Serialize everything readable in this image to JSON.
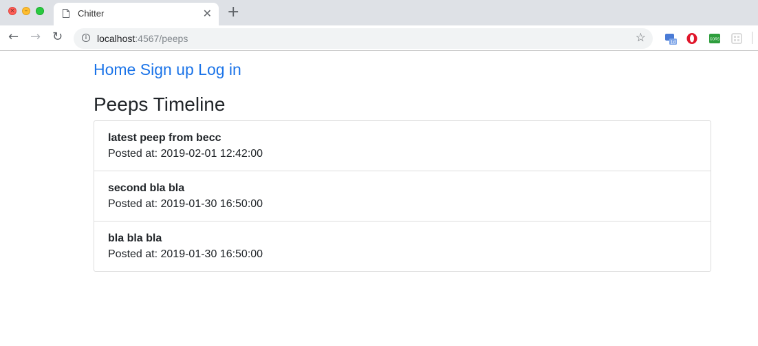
{
  "browser": {
    "tab_title": "Chitter",
    "url_host": "localhost",
    "url_rest": ":4567/peeps"
  },
  "nav": {
    "home": "Home",
    "signup": "Sign up",
    "login": "Log in"
  },
  "page_title": "Peeps Timeline",
  "peeps": [
    {
      "text": "latest peep from becc",
      "posted_label": "Posted at:",
      "posted_at": "2019-02-01 12:42:00"
    },
    {
      "text": "second bla bla",
      "posted_label": "Posted at:",
      "posted_at": "2019-01-30 16:50:00"
    },
    {
      "text": "bla bla bla",
      "posted_label": "Posted at:",
      "posted_at": "2019-01-30 16:50:00"
    }
  ],
  "extensions": {
    "ext1_badge": "1d",
    "ext3_label": "CORS"
  },
  "colors": {
    "link": "#1a73e8",
    "text": "#212529"
  }
}
